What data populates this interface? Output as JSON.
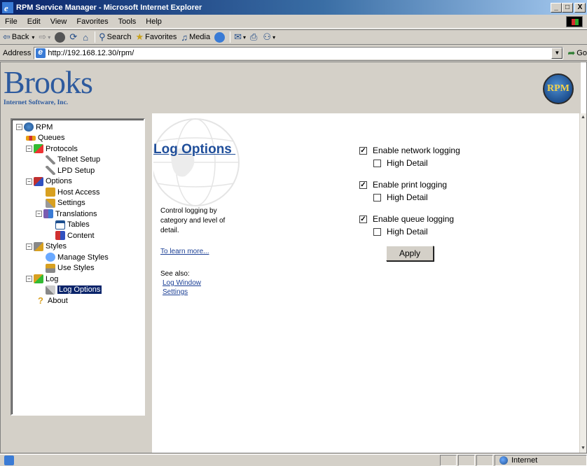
{
  "window": {
    "title": "RPM Service Manager - Microsoft Internet Explorer",
    "controls": {
      "minimize": "_",
      "maximize": "□",
      "close": "X"
    }
  },
  "menu": {
    "items": [
      "File",
      "Edit",
      "View",
      "Favorites",
      "Tools",
      "Help"
    ]
  },
  "toolbar": {
    "back": "Back",
    "search": "Search",
    "favorites": "Favorites",
    "media": "Media"
  },
  "address": {
    "label": "Address",
    "url": "http://192.168.12.30/rpm/",
    "go": "Go"
  },
  "brand": {
    "name": "Brooks",
    "tagline": "Internet Software, Inc.",
    "seal": "RPM"
  },
  "tree": {
    "root": "RPM",
    "queues": "Queues",
    "protocols": "Protocols",
    "telnet_setup": "Telnet Setup",
    "lpd_setup": "LPD Setup",
    "options": "Options",
    "host_access": "Host Access",
    "settings": "Settings",
    "translations": "Translations",
    "tables": "Tables",
    "content": "Content",
    "styles": "Styles",
    "manage_styles": "Manage Styles",
    "use_styles": "Use Styles",
    "log": "Log",
    "log_options": "Log Options",
    "about": "About"
  },
  "page": {
    "title": "Log Options ",
    "description": "Control logging by category and level of detail.",
    "learn_more": "To learn more...",
    "see_also_label": "See also:",
    "see_also_links": [
      "Log Window",
      "Settings"
    ]
  },
  "options": {
    "network": {
      "label": "Enable network logging",
      "checked": true,
      "detail_label": "High Detail",
      "detail_checked": false
    },
    "print": {
      "label": "Enable print logging",
      "checked": true,
      "detail_label": "High Detail",
      "detail_checked": false
    },
    "queue": {
      "label": "Enable queue logging",
      "checked": true,
      "detail_label": "High Detail",
      "detail_checked": false
    },
    "apply_label": "Apply"
  },
  "status": {
    "zone": "Internet"
  },
  "colors": {
    "title_blue": "#0a246a",
    "link_blue": "#1b3f95",
    "brand_blue": "#2d5a9e"
  }
}
